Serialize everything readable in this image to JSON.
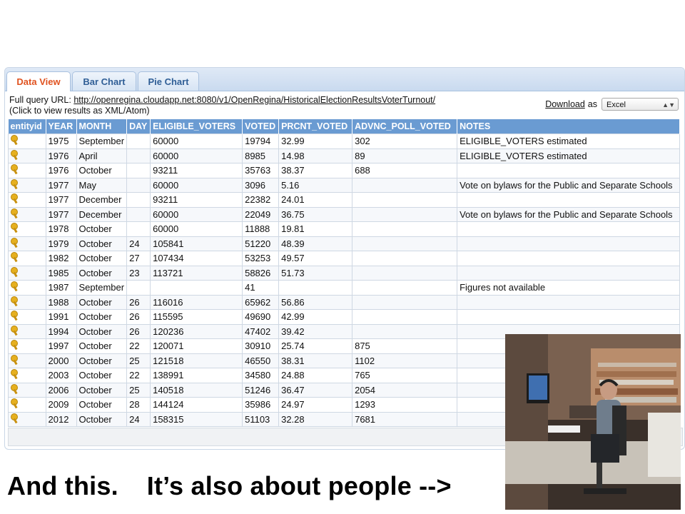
{
  "tabs": [
    "Data View",
    "Bar Chart",
    "Pie Chart"
  ],
  "query": {
    "prefix": "Full query URL:",
    "url": "http://openregina.cloudapp.net:8080/v1/OpenRegina/HistoricalElectionResultsVoterTurnout/",
    "hint": "(Click to view results as XML/Atom)"
  },
  "download": {
    "label": "Download",
    "as": "as",
    "format": "Excel"
  },
  "table": {
    "headers": [
      "entityid",
      "YEAR",
      "MONTH",
      "DAY",
      "ELIGIBLE_VOTERS",
      "VOTED",
      "PRCNT_VOTED",
      "ADVNC_POLL_VOTED",
      "NOTES"
    ],
    "rows": [
      [
        "",
        "1975",
        "September",
        "",
        "60000",
        "19794",
        "32.99",
        "302",
        "ELIGIBLE_VOTERS estimated"
      ],
      [
        "",
        "1976",
        "April",
        "",
        "60000",
        "8985",
        "14.98",
        "89",
        "ELIGIBLE_VOTERS estimated"
      ],
      [
        "",
        "1976",
        "October",
        "",
        "93211",
        "35763",
        "38.37",
        "688",
        ""
      ],
      [
        "",
        "1977",
        "May",
        "",
        "60000",
        "3096",
        "5.16",
        "",
        "Vote on bylaws for the Public and Separate Schools"
      ],
      [
        "",
        "1977",
        "December",
        "",
        "93211",
        "22382",
        "24.01",
        "",
        ""
      ],
      [
        "",
        "1977",
        "December",
        "",
        "60000",
        "22049",
        "36.75",
        "",
        "Vote on bylaws for the Public and Separate Schools"
      ],
      [
        "",
        "1978",
        "October",
        "",
        "60000",
        "11888",
        "19.81",
        "",
        ""
      ],
      [
        "",
        "1979",
        "October",
        "24",
        "105841",
        "51220",
        "48.39",
        "",
        ""
      ],
      [
        "",
        "1982",
        "October",
        "27",
        "107434",
        "53253",
        "49.57",
        "",
        ""
      ],
      [
        "",
        "1985",
        "October",
        "23",
        "113721",
        "58826",
        "51.73",
        "",
        ""
      ],
      [
        "",
        "1987",
        "September",
        "",
        "",
        "41",
        "",
        "",
        "Figures not available"
      ],
      [
        "",
        "1988",
        "October",
        "26",
        "116016",
        "65962",
        "56.86",
        "",
        ""
      ],
      [
        "",
        "1991",
        "October",
        "26",
        "115595",
        "49690",
        "42.99",
        "",
        ""
      ],
      [
        "",
        "1994",
        "October",
        "26",
        "120236",
        "47402",
        "39.42",
        "",
        ""
      ],
      [
        "",
        "1997",
        "October",
        "22",
        "120071",
        "30910",
        "25.74",
        "875",
        ""
      ],
      [
        "",
        "2000",
        "October",
        "25",
        "121518",
        "46550",
        "38.31",
        "1102",
        ""
      ],
      [
        "",
        "2003",
        "October",
        "22",
        "138991",
        "34580",
        "24.88",
        "765",
        ""
      ],
      [
        "",
        "2006",
        "October",
        "25",
        "140518",
        "51246",
        "36.47",
        "2054",
        ""
      ],
      [
        "",
        "2009",
        "October",
        "28",
        "144124",
        "35986",
        "24.97",
        "1293",
        ""
      ],
      [
        "",
        "2012",
        "October",
        "24",
        "158315",
        "51103",
        "32.28",
        "7681",
        ""
      ]
    ]
  },
  "caption": {
    "part1": "And this.",
    "part2": "It’s also about people -->"
  },
  "colors": {
    "header": "#6a9bd2",
    "active_tab_text": "#e0521f",
    "tab_text": "#2f5e96"
  }
}
